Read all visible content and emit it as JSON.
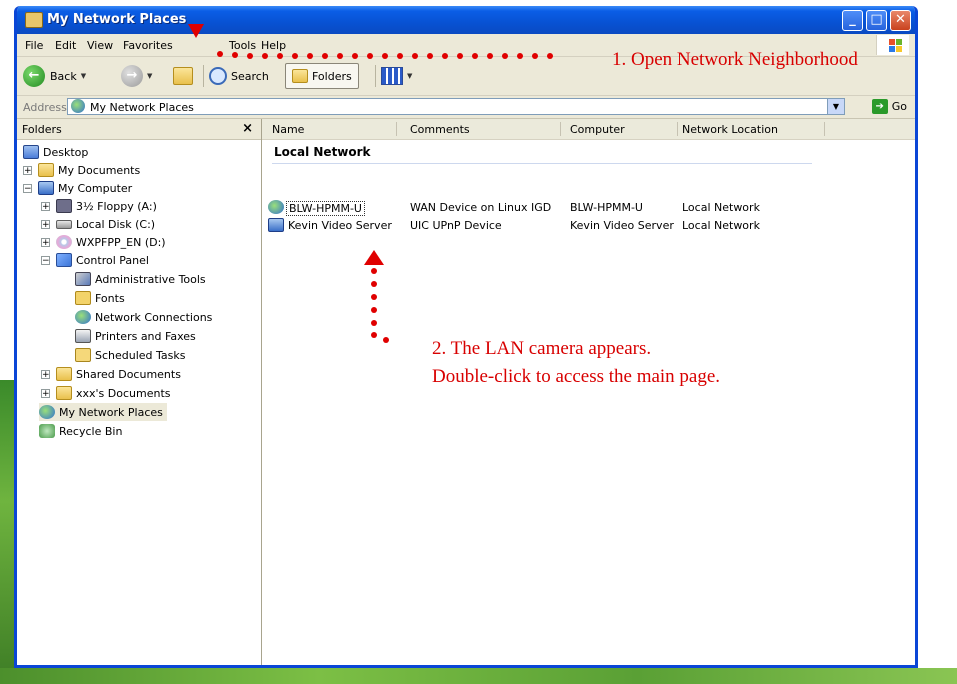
{
  "window": {
    "title": "My Network Places"
  },
  "menu": {
    "items": [
      "File",
      "Edit",
      "View",
      "Favorites",
      "Tools",
      "Help"
    ]
  },
  "toolbar": {
    "back": "Back",
    "search": "Search",
    "folders": "Folders"
  },
  "address": {
    "label": "Address",
    "value": "My Network Places",
    "go": "Go"
  },
  "folders_pane": {
    "title": "Folders",
    "close": "×",
    "items": [
      {
        "label": "Desktop",
        "icon": "desktop-icon"
      },
      {
        "label": "My Documents",
        "icon": "folder-icon"
      },
      {
        "label": "My Computer",
        "icon": "computer-icon"
      },
      {
        "label": "3½ Floppy (A:)",
        "icon": "floppy-icon"
      },
      {
        "label": "Local Disk (C:)",
        "icon": "disk-icon"
      },
      {
        "label": "WXPFPP_EN (D:)",
        "icon": "cd-icon"
      },
      {
        "label": "Control Panel",
        "icon": "control-panel-icon"
      },
      {
        "label": "Administrative Tools",
        "icon": "tools-icon"
      },
      {
        "label": "Fonts",
        "icon": "fonts-folder-icon"
      },
      {
        "label": "Network Connections",
        "icon": "network-icon"
      },
      {
        "label": "Printers and Faxes",
        "icon": "printer-icon"
      },
      {
        "label": "Scheduled Tasks",
        "icon": "tasks-icon"
      },
      {
        "label": "Shared Documents",
        "icon": "folder-icon"
      },
      {
        "label": "xxx's Documents",
        "icon": "folder-icon"
      },
      {
        "label": "My Network Places",
        "icon": "network-places-icon"
      },
      {
        "label": "Recycle Bin",
        "icon": "recycle-bin-icon"
      }
    ]
  },
  "content": {
    "columns": [
      "Name",
      "Comments",
      "Computer",
      "Network Location"
    ],
    "group": "Local Network",
    "rows": [
      {
        "name": "BLW-HPMM-U",
        "comments": "WAN Device on Linux IGD",
        "computer": "BLW-HPMM-U",
        "location": "Local Network"
      },
      {
        "name": "Kevin Video Server",
        "comments": "UIC UPnP Device",
        "computer": "Kevin Video Server",
        "location": "Local Network"
      }
    ]
  },
  "annotations": {
    "step1": "1. Open Network Neighborhood",
    "step2_line1": "2. The LAN camera appears.",
    "step2_line2": "Double-click to access the main page."
  },
  "colors": {
    "annotation": "#d80000",
    "titlebar": "#0852d3"
  }
}
